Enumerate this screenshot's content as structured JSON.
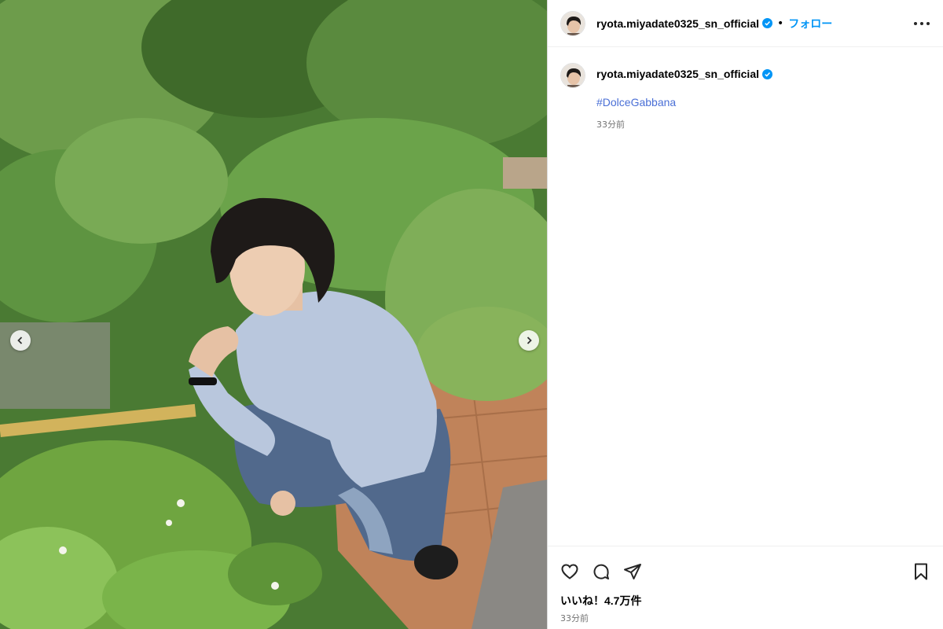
{
  "post": {
    "username": "ryota.miyadate0325_sn_official",
    "follow_label": "フォロー",
    "separator": "•",
    "caption_hashtag": "#DolceGabbana",
    "caption_time": "33分前",
    "likes_text": "いいね！4.7万件",
    "post_time": "33分前"
  },
  "icons": {
    "verified": "verified-badge-icon",
    "more": "more-options-icon",
    "like": "heart-icon",
    "comment": "comment-icon",
    "share": "share-icon",
    "save": "bookmark-icon",
    "prev": "chevron-left-icon",
    "next": "chevron-right-icon"
  },
  "colors": {
    "accent": "#0095f6",
    "hashtag": "#4a6fd6",
    "verified": "#0095f6",
    "muted": "#737373"
  }
}
